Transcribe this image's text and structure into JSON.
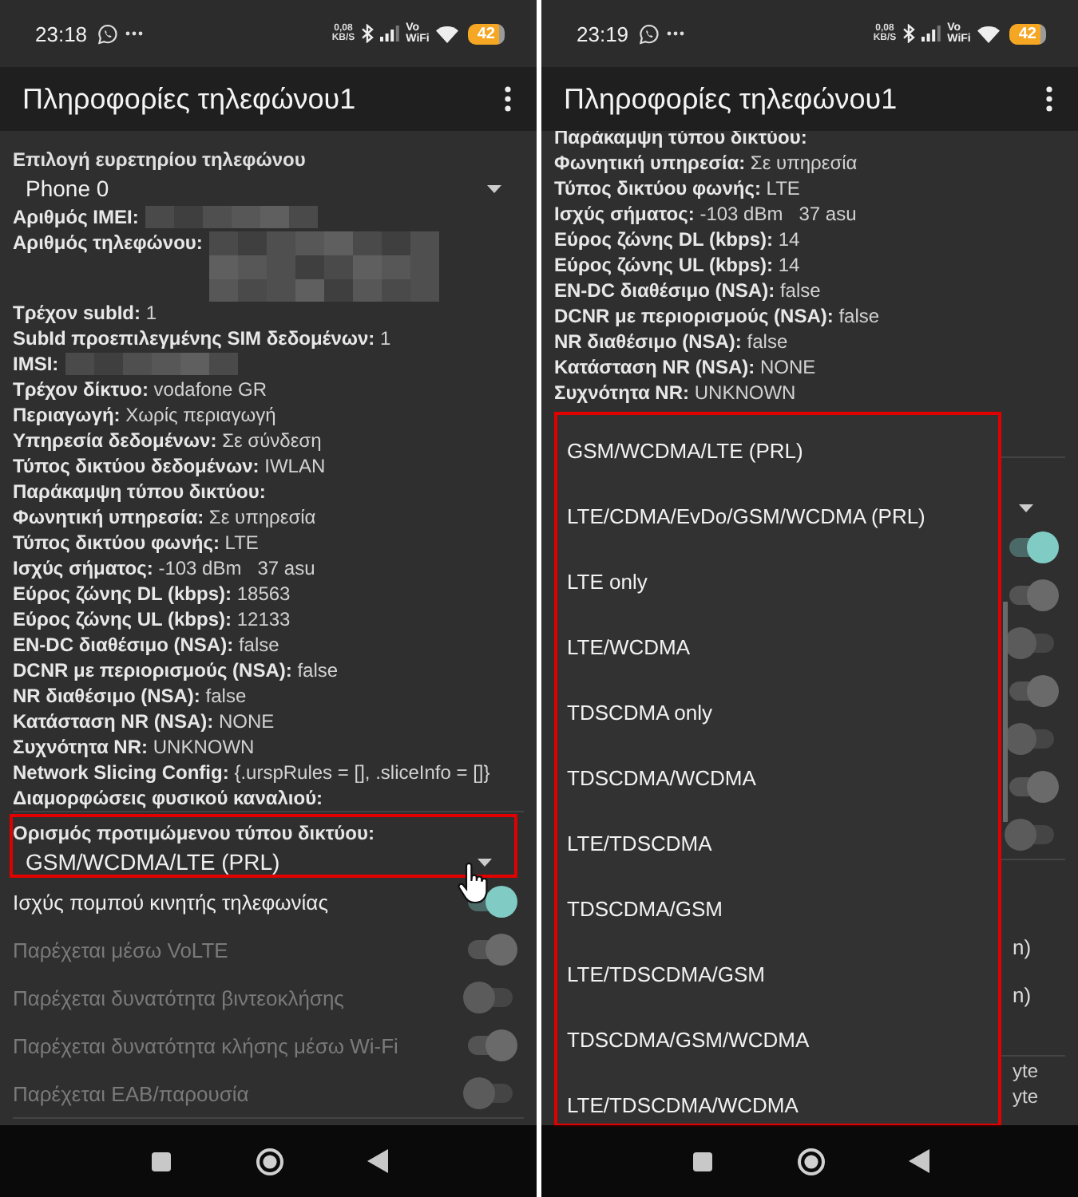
{
  "phones": [
    {
      "status_bar": {
        "time": "23:18",
        "speed_value": "0,08",
        "speed_unit": "KB/S",
        "vowifi_top": "Vo",
        "vowifi_bottom": "WiFi",
        "battery": "42"
      },
      "app_bar": {
        "title": "Πληροφορίες τηλεφώνου1"
      },
      "phone_index": {
        "label": "Επιλογή ευρετηρίου τηλεφώνου",
        "value": "Phone 0"
      },
      "info": [
        {
          "kind": "redacted",
          "label": "Αριθμός IMEI:"
        },
        {
          "kind": "redacted_tall",
          "label": "Αριθμός τηλεφώνου:"
        },
        {
          "kind": "text",
          "label": "Τρέχον subId:",
          "value": "1"
        },
        {
          "kind": "text",
          "label": "SubId προεπιλεγμένης SIM δεδομένων:",
          "value": "1"
        },
        {
          "kind": "redacted",
          "label": "IMSI:"
        },
        {
          "kind": "text",
          "label": "Τρέχον δίκτυο:",
          "value": "vodafone GR"
        },
        {
          "kind": "text",
          "label": "Περιαγωγή:",
          "value": "Χωρίς περιαγωγή"
        },
        {
          "kind": "text",
          "label": "Υπηρεσία δεδομένων:",
          "value": "Σε σύνδεση"
        },
        {
          "kind": "text",
          "label": "Τύπος δικτύου δεδομένων:",
          "value": "IWLAN"
        },
        {
          "kind": "text",
          "label": "Παράκαμψη τύπου δικτύου:"
        },
        {
          "kind": "text",
          "label": "Φωνητική υπηρεσία:",
          "value": "Σε υπηρεσία"
        },
        {
          "kind": "text",
          "label": "Τύπος δικτύου φωνής:",
          "value": "LTE"
        },
        {
          "kind": "text",
          "label": "Ισχύς σήματος:",
          "value": "-103 dBm   37 asu"
        },
        {
          "kind": "text",
          "label": "Εύρος ζώνης DL (kbps):",
          "value": "18563"
        },
        {
          "kind": "text",
          "label": "Εύρος ζώνης UL (kbps):",
          "value": "12133"
        },
        {
          "kind": "text",
          "label": "EN-DC διαθέσιμο (NSA):",
          "value": "false"
        },
        {
          "kind": "text",
          "label": "DCNR με περιορισμούς (NSA):",
          "value": "false"
        },
        {
          "kind": "text",
          "label": "NR διαθέσιμο (NSA):",
          "value": "false"
        },
        {
          "kind": "text",
          "label": "Κατάσταση NR (NSA):",
          "value": "NONE"
        },
        {
          "kind": "text",
          "label": "Συχνότητα NR:",
          "value": "UNKNOWN"
        },
        {
          "kind": "text",
          "label": "Network Slicing Config:",
          "value": "{.urspRules = [], .sliceInfo = []}"
        },
        {
          "kind": "text",
          "label": "Διαμορφώσεις φυσικού καναλιού:"
        }
      ],
      "settings": [
        {
          "kind": "divider"
        },
        {
          "kind": "spinner",
          "label": "Ορισμός προτιμώμενου τύπου δικτύου:",
          "value": "GSM/WCDMA/LTE (PRL)",
          "highlighted": true
        },
        {
          "kind": "switch",
          "label": "Ισχύς πομπού κινητής τηλεφωνίας",
          "on": true,
          "enabled": true
        },
        {
          "kind": "switch",
          "label": "Παρέχεται μέσω VoLTE",
          "on": true,
          "enabled": false
        },
        {
          "kind": "switch",
          "label": "Παρέχεται δυνατότητα βιντεοκλήσης",
          "on": false,
          "enabled": false
        },
        {
          "kind": "switch",
          "label": "Παρέχεται δυνατότητα κλήσης μέσω Wi-Fi",
          "on": true,
          "enabled": false
        },
        {
          "kind": "switch",
          "label": "Παρέχεται EAB/παρουσία",
          "on": false,
          "enabled": false
        },
        {
          "kind": "divider"
        }
      ],
      "pointer_cursor": true
    },
    {
      "status_bar": {
        "time": "23:19",
        "speed_value": "0,08",
        "speed_unit": "KB/S",
        "vowifi_top": "Vo",
        "vowifi_bottom": "WiFi",
        "battery": "42"
      },
      "app_bar": {
        "title": "Πληροφορίες τηλεφώνου1"
      },
      "info": [
        {
          "kind": "text",
          "label": "Παράκαμψη τύπου δικτύου:"
        },
        {
          "kind": "text",
          "label": "Φωνητική υπηρεσία:",
          "value": "Σε υπηρεσία"
        },
        {
          "kind": "text",
          "label": "Τύπος δικτύου φωνής:",
          "value": "LTE"
        },
        {
          "kind": "text",
          "label": "Ισχύς σήματος:",
          "value": "-103 dBm   37 asu"
        },
        {
          "kind": "text",
          "label": "Εύρος ζώνης DL (kbps):",
          "value": "14"
        },
        {
          "kind": "text",
          "label": "Εύρος ζώνης UL (kbps):",
          "value": "14"
        },
        {
          "kind": "text",
          "label": "EN-DC διαθέσιμο (NSA):",
          "value": "false"
        },
        {
          "kind": "text",
          "label": "DCNR με περιορισμούς (NSA):",
          "value": "false"
        },
        {
          "kind": "text",
          "label": "NR διαθέσιμο (NSA):",
          "value": "false"
        },
        {
          "kind": "text",
          "label": "Κατάσταση NR (NSA):",
          "value": "NONE"
        },
        {
          "kind": "text",
          "label": "Συχνότητα NR:",
          "value": "UNKNOWN"
        }
      ],
      "settings": [
        {
          "kind": "divider"
        },
        {
          "kind": "spinner",
          "highlighted": false
        },
        {
          "kind": "switch",
          "on": true,
          "enabled": true
        },
        {
          "kind": "switch",
          "on": true,
          "enabled": false
        },
        {
          "kind": "switch",
          "on": false,
          "enabled": false
        },
        {
          "kind": "switch",
          "on": true,
          "enabled": false
        },
        {
          "kind": "switch",
          "on": false,
          "enabled": false
        },
        {
          "kind": "switch",
          "on": true,
          "enabled": false
        },
        {
          "kind": "switch",
          "on": false,
          "enabled": false
        },
        {
          "kind": "divider"
        },
        {
          "kind": "fragment",
          "text": "n)"
        },
        {
          "kind": "fragment",
          "text": "n)"
        },
        {
          "kind": "divider"
        },
        {
          "kind": "fragment_line",
          "text": "yte"
        },
        {
          "kind": "fragment_line",
          "text": "yte"
        }
      ],
      "dropdown": {
        "highlighted": true,
        "options": [
          "GSM/WCDMA/LTE (PRL)",
          "LTE/CDMA/EvDo/GSM/WCDMA (PRL)",
          "LTE only",
          "LTE/WCDMA",
          "TDSCDMA only",
          "TDSCDMA/WCDMA",
          "LTE/TDSCDMA",
          "TDSCDMA/GSM",
          "LTE/TDSCDMA/GSM",
          "TDSCDMA/GSM/WCDMA",
          "LTE/TDSCDMA/WCDMA"
        ]
      }
    }
  ]
}
